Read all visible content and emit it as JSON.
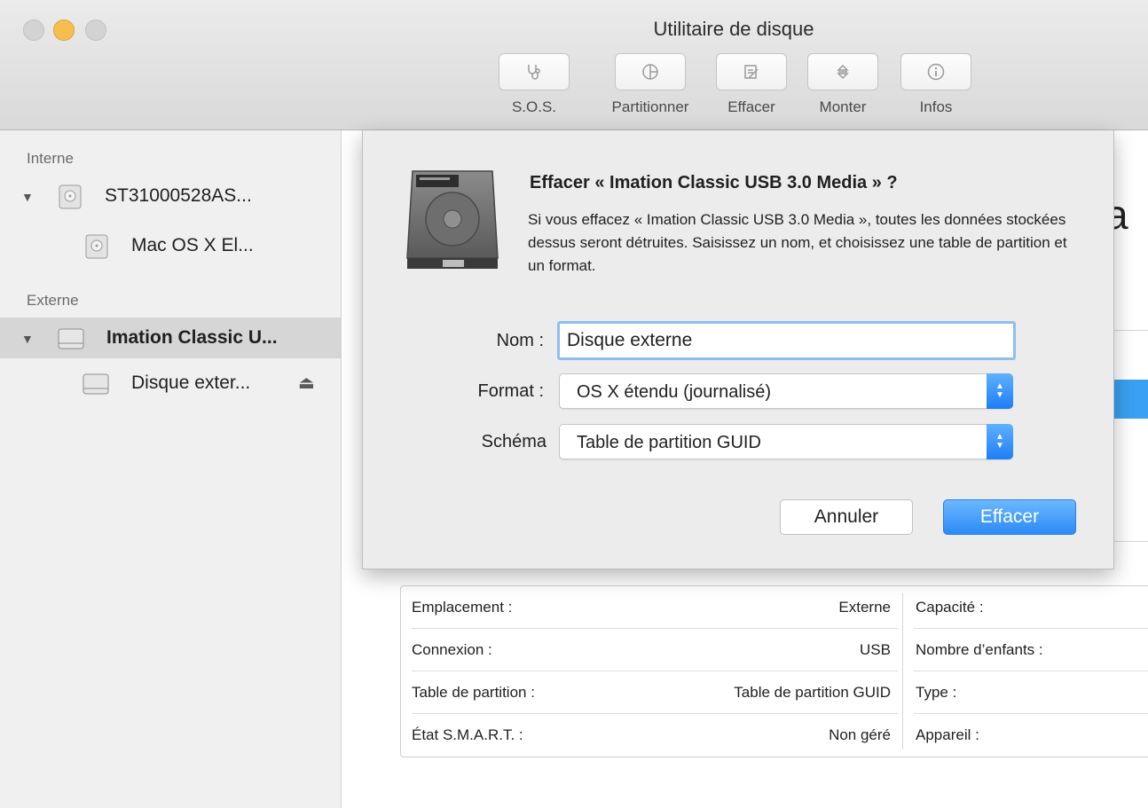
{
  "window": {
    "title": "Utilitaire de disque"
  },
  "toolbar": {
    "items": [
      {
        "label": "S.O.S.",
        "icon": "stethoscope-icon"
      },
      {
        "label": "Partitionner",
        "icon": "pie-chart-icon"
      },
      {
        "label": "Effacer",
        "icon": "eraser-icon"
      },
      {
        "label": "Monter",
        "icon": "mount-icon"
      },
      {
        "label": "Infos",
        "icon": "info-icon"
      }
    ]
  },
  "sidebar": {
    "internal_header": "Interne",
    "external_header": "Externe",
    "items": [
      {
        "label": "ST31000528AS...",
        "icon": "internal-disk-icon",
        "selected": false
      },
      {
        "label": "Mac OS X El...",
        "icon": "internal-volume-icon",
        "selected": false
      },
      {
        "label": "Imation Classic U...",
        "icon": "external-disk-icon",
        "selected": true
      },
      {
        "label": "Disque exter...",
        "icon": "external-volume-icon",
        "selected": false,
        "eject": "⏏"
      }
    ]
  },
  "main": {
    "partial_title_letter": "a",
    "info": {
      "rows": [
        {
          "key": "Emplacement :",
          "value": "Externe",
          "key2": "Capacité :"
        },
        {
          "key": "Connexion :",
          "value": "USB",
          "key2": "Nombre d’enfants :"
        },
        {
          "key": "Table de partition :",
          "value": "Table de partition GUID",
          "key2": "Type :"
        },
        {
          "key": "État S.M.A.R.T. :",
          "value": "Non géré",
          "key2": "Appareil :"
        }
      ]
    }
  },
  "sheet": {
    "title": "Effacer « Imation Classic USB 3.0 Media » ?",
    "message": "Si vous effacez « Imation Classic USB 3.0 Media », toutes les données stockées dessus seront détruites. Saisissez un nom, et choisissez une table de partition et un format.",
    "name_label": "Nom :",
    "name_value": "Disque externe",
    "format_label": "Format :",
    "format_value": "OS X étendu (journalisé)",
    "scheme_label": "Schéma",
    "scheme_value": "Table de partition GUID",
    "cancel_label": "Annuler",
    "erase_label": "Effacer"
  }
}
